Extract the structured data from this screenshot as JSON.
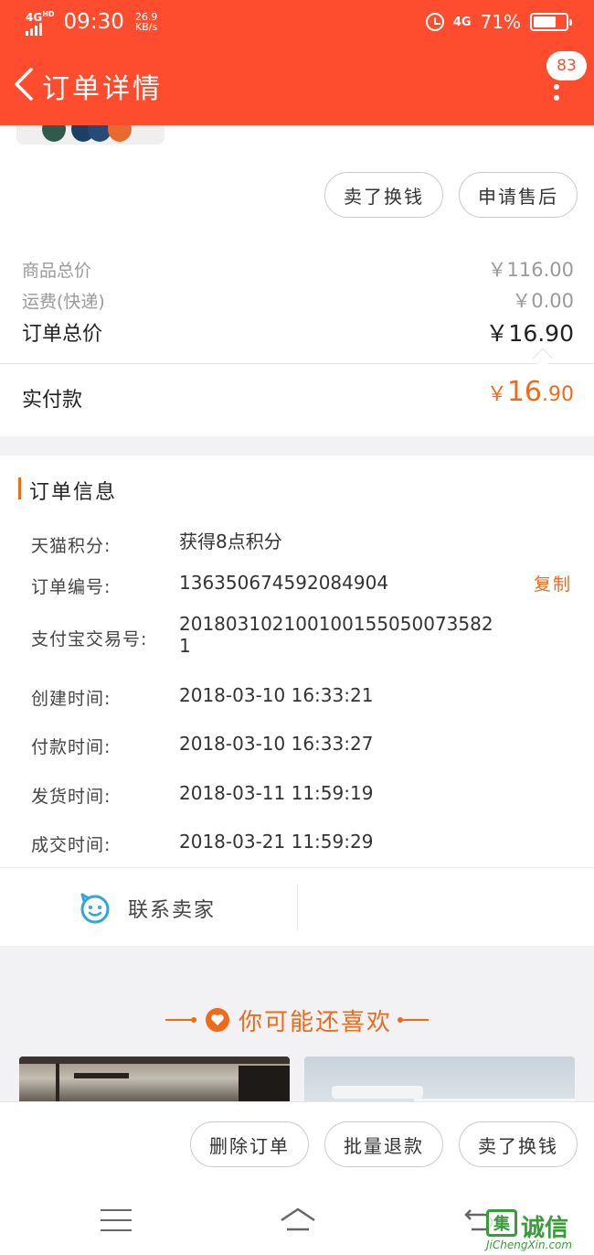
{
  "status_bar": {
    "network": "4G",
    "network_sub": "HD",
    "time": "09:30",
    "speed_value": "26.9",
    "speed_unit": "KB/s",
    "network_right": "4G",
    "battery": "71%",
    "battery_level": 0.71
  },
  "nav": {
    "title": "订单详情",
    "badge": "83"
  },
  "order_actions": {
    "sell_label": "卖了换钱",
    "after_sale_label": "申请售后"
  },
  "prices": {
    "goods_total_label": "商品总价",
    "goods_total_value": "￥116.00",
    "shipping_label": "运费(快递)",
    "shipping_value": "￥0.00",
    "order_total_label": "订单总价",
    "order_total_value": "￥16.90",
    "paid_label": "实付款",
    "paid_currency": "￥",
    "paid_int": "16",
    "paid_dec": ".90"
  },
  "order_info": {
    "title": "订单信息",
    "rows": [
      {
        "label": "天猫积分:",
        "value": "获得8点积分"
      },
      {
        "label": "订单编号:",
        "value": "136350674592084904"
      },
      {
        "label": "支付宝交易号:",
        "value": "2018031021001001550500735821"
      },
      {
        "label": "创建时间:",
        "value": "2018-03-10 16:33:21"
      },
      {
        "label": "付款时间:",
        "value": "2018-03-10 16:33:27"
      },
      {
        "label": "发货时间:",
        "value": "2018-03-11 11:59:19"
      },
      {
        "label": "成交时间:",
        "value": "2018-03-21 11:59:29"
      }
    ],
    "copy_label": "复制",
    "contact_label": "联系卖家"
  },
  "recommend": {
    "title": "你可能还喜欢"
  },
  "bottom_actions": {
    "delete_label": "删除订单",
    "bulk_refund_label": "批量退款",
    "sell_label": "卖了换钱"
  },
  "watermark": {
    "logo_char": "集",
    "name": "诚信",
    "url": "JiChengXin.com"
  },
  "colors": {
    "brand": "#fd4d2e",
    "accent": "#f06a1a",
    "contact_icon": "#2fa6de"
  }
}
